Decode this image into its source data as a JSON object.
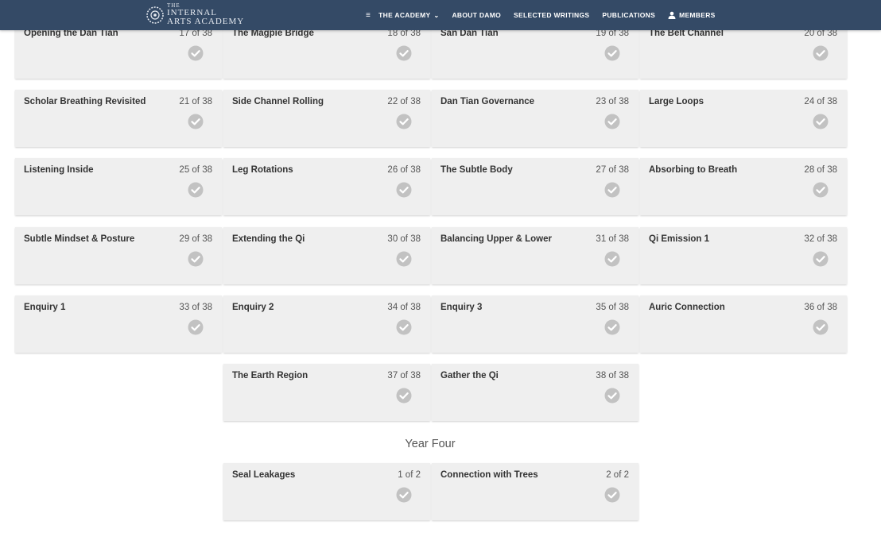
{
  "nav": {
    "logo_line1": "THE",
    "logo_line2": "INTERNAL",
    "logo_line3": "ARTS ACADEMY",
    "menu_icon": "hamburger-icon",
    "items": [
      {
        "label": "THE ACADEMY"
      },
      {
        "label": "ABOUT DAMO"
      },
      {
        "label": "SELECTED WRITINGS"
      },
      {
        "label": "PUBLICATIONS"
      },
      {
        "label": "MEMBERS"
      }
    ]
  },
  "year_three_lessons": [
    {
      "title": "Opening the Dan Tian",
      "count": "17 of 38",
      "completed": true
    },
    {
      "title": "The Magpie Bridge",
      "count": "18 of 38",
      "completed": true
    },
    {
      "title": "San Dan Tian",
      "count": "19 of 38",
      "completed": true
    },
    {
      "title": "The Belt Channel",
      "count": "20 of 38",
      "completed": true
    },
    {
      "title": "Scholar Breathing Revisited",
      "count": "21 of 38",
      "completed": true
    },
    {
      "title": "Side Channel Rolling",
      "count": "22 of 38",
      "completed": true
    },
    {
      "title": "Dan Tian Governance",
      "count": "23 of 38",
      "completed": true
    },
    {
      "title": "Large Loops",
      "count": "24 of 38",
      "completed": true
    },
    {
      "title": "Listening Inside",
      "count": "25 of 38",
      "completed": true
    },
    {
      "title": "Leg Rotations",
      "count": "26 of 38",
      "completed": true
    },
    {
      "title": "The Subtle Body",
      "count": "27 of 38",
      "completed": true
    },
    {
      "title": "Absorbing to Breath",
      "count": "28 of 38",
      "completed": true
    },
    {
      "title": "Subtle Mindset & Posture",
      "count": "29 of 38",
      "completed": true
    },
    {
      "title": "Extending the Qi",
      "count": "30 of 38",
      "completed": true
    },
    {
      "title": "Balancing Upper & Lower",
      "count": "31 of 38",
      "completed": true
    },
    {
      "title": "Qi Emission 1",
      "count": "32 of 38",
      "completed": true
    },
    {
      "title": "Enquiry 1",
      "count": "33 of 38",
      "completed": true
    },
    {
      "title": "Enquiry 2",
      "count": "34 of 38",
      "completed": true
    },
    {
      "title": "Enquiry 3",
      "count": "35 of 38",
      "completed": true
    },
    {
      "title": "Auric Connection",
      "count": "36 of 38",
      "completed": true
    },
    {
      "title": "The Earth Region",
      "count": "37 of 38",
      "completed": true
    },
    {
      "title": "Gather the Qi",
      "count": "38 of 38",
      "completed": true
    }
  ],
  "year_four": {
    "heading": "Year Four",
    "lessons": [
      {
        "title": "Seal Leakages",
        "count": "1 of 2",
        "completed": true
      },
      {
        "title": "Connection with Trees",
        "count": "2 of 2",
        "completed": true
      }
    ]
  },
  "colors": {
    "nav_bg": "#344a66",
    "card_bg": "#efefef",
    "check_color": "#c2c2c2"
  },
  "icons": {
    "check": "check-circle-icon",
    "user": "user-icon",
    "chevron": "chevron-down-icon"
  }
}
